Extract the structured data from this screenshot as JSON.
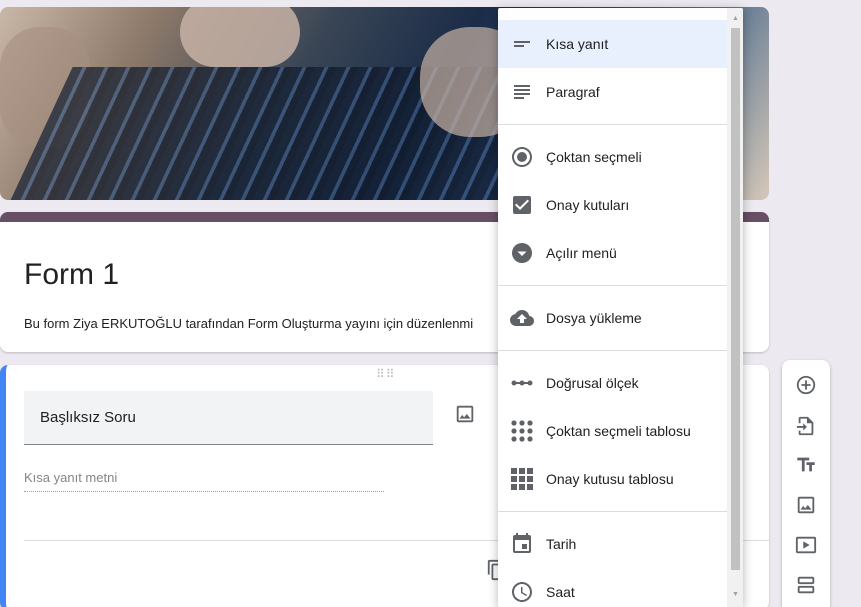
{
  "form": {
    "title": "Form 1",
    "description": "Bu form Ziya ERKUTOĞLU tarafından Form Oluşturma yayını için düzenlenmi"
  },
  "question": {
    "title": "Başlıksız Soru",
    "answer_placeholder": "Kısa yanıt metni"
  },
  "menu": {
    "items": [
      {
        "label": "Kısa yanıt",
        "icon": "short-text-icon",
        "selected": true
      },
      {
        "label": "Paragraf",
        "icon": "paragraph-icon"
      },
      {
        "label": "Çoktan seçmeli",
        "icon": "radio-icon"
      },
      {
        "label": "Onay kutuları",
        "icon": "checkbox-icon"
      },
      {
        "label": "Açılır menü",
        "icon": "dropdown-icon"
      },
      {
        "label": "Dosya yükleme",
        "icon": "upload-icon"
      },
      {
        "label": "Doğrusal ölçek",
        "icon": "linear-scale-icon"
      },
      {
        "label": "Çoktan seçmeli tablosu",
        "icon": "grid-dots-icon"
      },
      {
        "label": "Onay kutusu tablosu",
        "icon": "grid-squares-icon"
      },
      {
        "label": "Tarih",
        "icon": "calendar-icon"
      },
      {
        "label": "Saat",
        "icon": "clock-icon"
      }
    ]
  },
  "colors": {
    "accent": "#674e64",
    "question_accent": "#4285f4",
    "selected_bg": "#e8f0fe",
    "icon": "#5f6368"
  }
}
